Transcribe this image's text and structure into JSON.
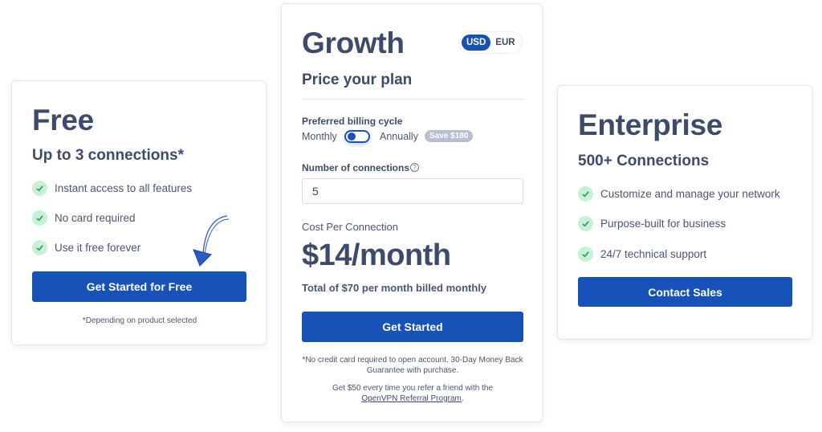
{
  "free": {
    "title": "Free",
    "subtitle": "Up to 3 connections*",
    "features": [
      "Instant access to all features",
      "No card required",
      "Use it free forever"
    ],
    "cta": "Get Started for Free",
    "footnote": "*Depending on product selected"
  },
  "growth": {
    "title": "Growth",
    "currency_options": [
      "USD",
      "EUR"
    ],
    "currency_selected": "USD",
    "subtitle": "Price your plan",
    "billing_label": "Preferred billing cycle",
    "billing_monthly": "Monthly",
    "billing_annually": "Annually",
    "billing_selected": "Monthly",
    "save_badge": "Save $180",
    "connections_label": "Number of connections",
    "connections_value": "5",
    "cost_label": "Cost Per Connection",
    "price": "$14/month",
    "total": "Total of $70 per month billed monthly",
    "cta": "Get Started",
    "note1": "*No credit card required to open account. 30-Day Money Back Guarantee with purchase.",
    "note2": "Get $50 every time you refer a friend with the",
    "referral_link": "OpenVPN Referral Program",
    "note2_end": "."
  },
  "enterprise": {
    "title": "Enterprise",
    "subtitle": "500+ Connections",
    "features": [
      "Customize and manage your network",
      "Purpose-built for business",
      "24/7 technical support"
    ],
    "cta": "Contact Sales"
  },
  "colors": {
    "primary": "#1652b8",
    "heading": "#3d4b6b",
    "check_bg": "#c8f0d4",
    "check_mark": "#2a9a5a"
  }
}
